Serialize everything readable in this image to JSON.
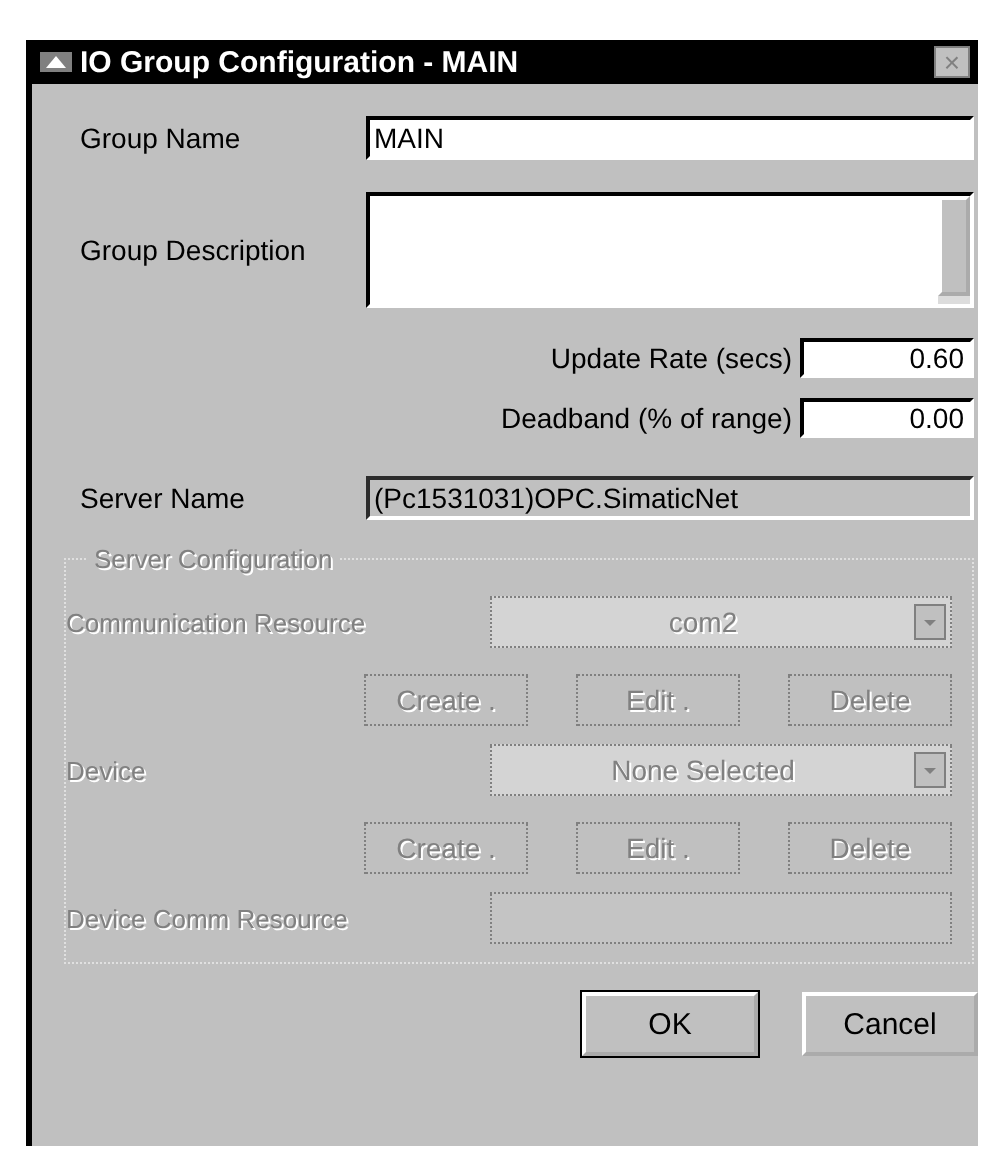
{
  "window": {
    "title": "IO Group Configuration - MAIN",
    "close": "×"
  },
  "group_name": {
    "label": "Group Name",
    "value": "MAIN"
  },
  "group_description": {
    "label": "Group Description"
  },
  "update_rate": {
    "label": "Update Rate (secs)",
    "value": "0.60"
  },
  "deadband": {
    "label": "Deadband (% of range)",
    "value": "0.00"
  },
  "server_name": {
    "label": "Server Name",
    "value": "(Pc1531031)OPC.SimaticNet"
  },
  "server_configuration": {
    "title": "Server Configuration",
    "disabled": true,
    "communication_resource": {
      "label": "Communication Resource",
      "value": "com2",
      "buttons": [
        "Create .",
        "Edit .",
        "Delete"
      ]
    },
    "device": {
      "label": "Device",
      "value": "None Selected",
      "buttons": [
        "Create .",
        "Edit .",
        "Delete"
      ]
    },
    "device_comm_resource": {
      "label": "Device Comm Resource"
    }
  },
  "buttons": [
    {
      "label": "OK",
      "default": true
    },
    {
      "label": "Cancel",
      "default": false
    }
  ]
}
